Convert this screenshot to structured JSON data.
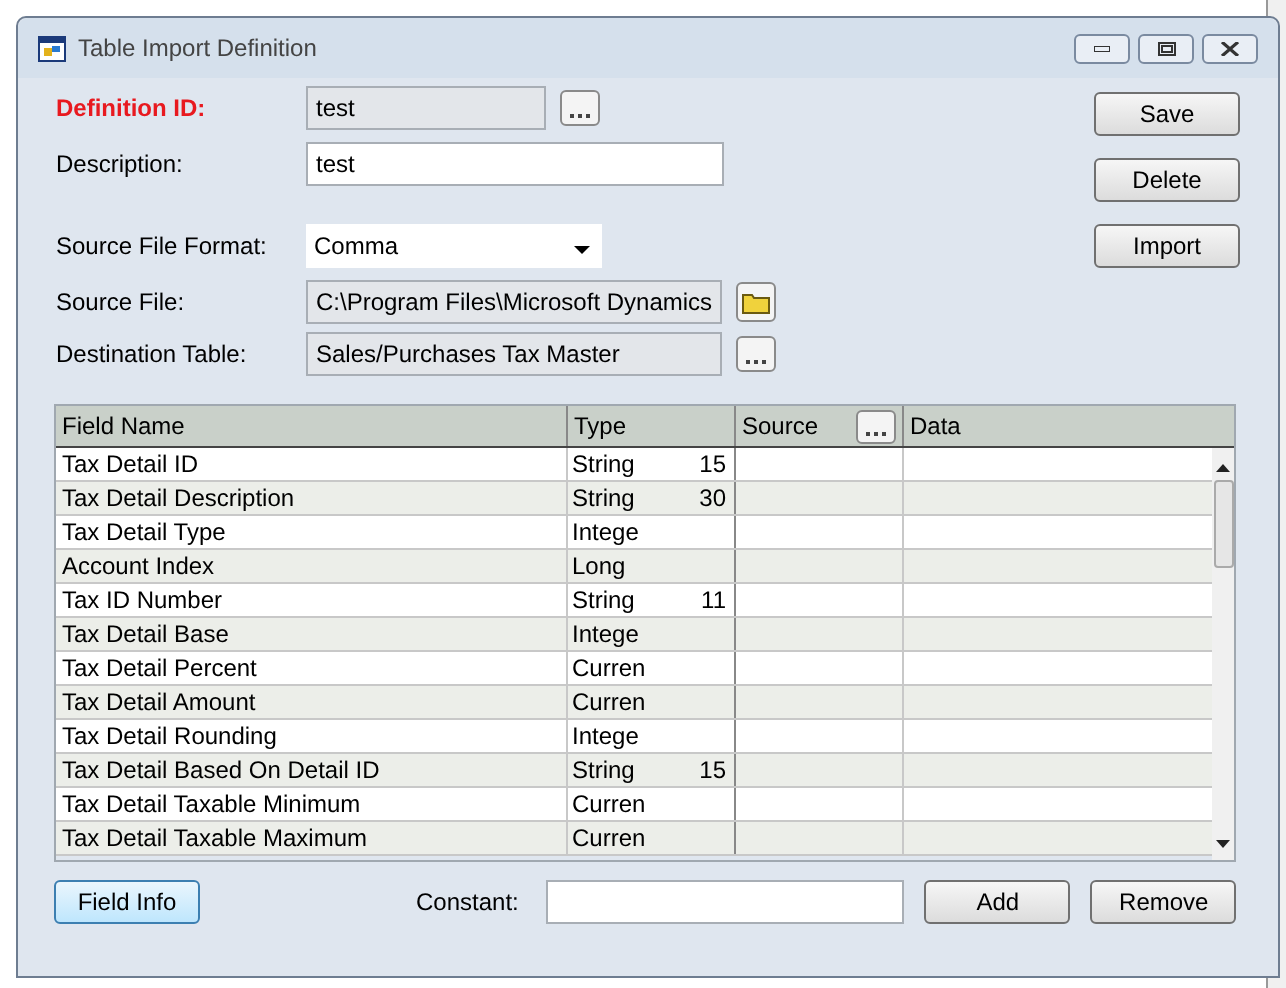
{
  "window": {
    "title": "Table Import Definition"
  },
  "form": {
    "definition_id": {
      "label": "Definition ID:",
      "value": "test",
      "required": true
    },
    "description": {
      "label": "Description:",
      "value": "test"
    },
    "source_file_format": {
      "label": "Source File Format:",
      "value": "Comma"
    },
    "source_file": {
      "label": "Source File:",
      "value": "C:\\Program Files\\Microsoft Dynamics"
    },
    "destination_table": {
      "label": "Destination Table:",
      "value": "Sales/Purchases Tax Master"
    }
  },
  "actions": [
    "Save",
    "Delete",
    "Import"
  ],
  "table": {
    "columns": [
      "Field Name",
      "Type",
      "Source",
      "Data"
    ],
    "rows": [
      {
        "field_name": "Tax Detail ID",
        "type": "String",
        "length": "15"
      },
      {
        "field_name": "Tax Detail Description",
        "type": "String",
        "length": "30"
      },
      {
        "field_name": "Tax Detail Type",
        "type": "Intege"
      },
      {
        "field_name": "Account Index",
        "type": "Long"
      },
      {
        "field_name": "Tax ID Number",
        "type": "String",
        "length": "11"
      },
      {
        "field_name": "Tax Detail Base",
        "type": "Intege"
      },
      {
        "field_name": "Tax Detail Percent",
        "type": "Curren"
      },
      {
        "field_name": "Tax Detail Amount",
        "type": "Curren"
      },
      {
        "field_name": "Tax Detail Rounding",
        "type": "Intege"
      },
      {
        "field_name": "Tax Detail Based On Detail ID",
        "type": "String",
        "length": "15"
      },
      {
        "field_name": "Tax Detail Taxable Minimum",
        "type": "Curren"
      },
      {
        "field_name": "Tax Detail Taxable Maximum",
        "type": "Curren"
      }
    ]
  },
  "footer": {
    "field_info": "Field Info",
    "constant_label": "Constant:",
    "buttons": [
      "Add",
      "Remove"
    ]
  }
}
